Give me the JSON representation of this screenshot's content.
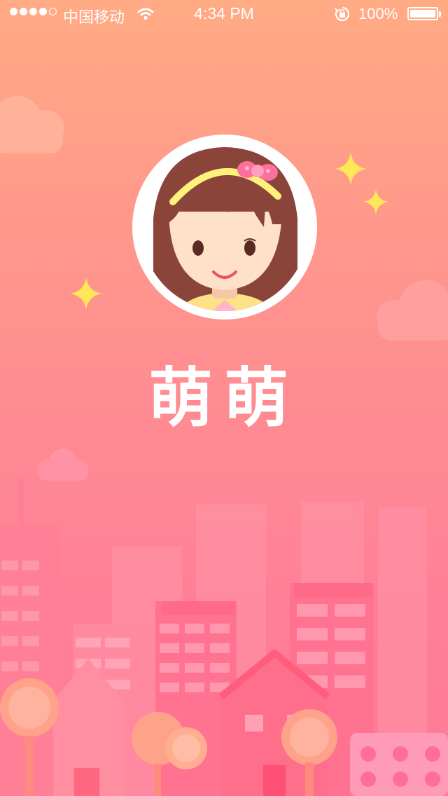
{
  "status_bar": {
    "signal_bars_filled": 4,
    "signal_bars_total": 5,
    "carrier": "中国移动",
    "time": "4:34 PM",
    "battery_percent": "100%"
  },
  "splash": {
    "app_name": "萌萌"
  },
  "colors": {
    "background_top": "#ffab84",
    "background_bottom": "#ff7a98",
    "sparkle": "#ffe75a",
    "text": "#ffffff"
  },
  "icons": [
    "signal-icon",
    "wifi-icon",
    "rotation-lock-icon",
    "battery-icon",
    "sparkle-icon",
    "cloud-icon",
    "avatar-girl"
  ]
}
